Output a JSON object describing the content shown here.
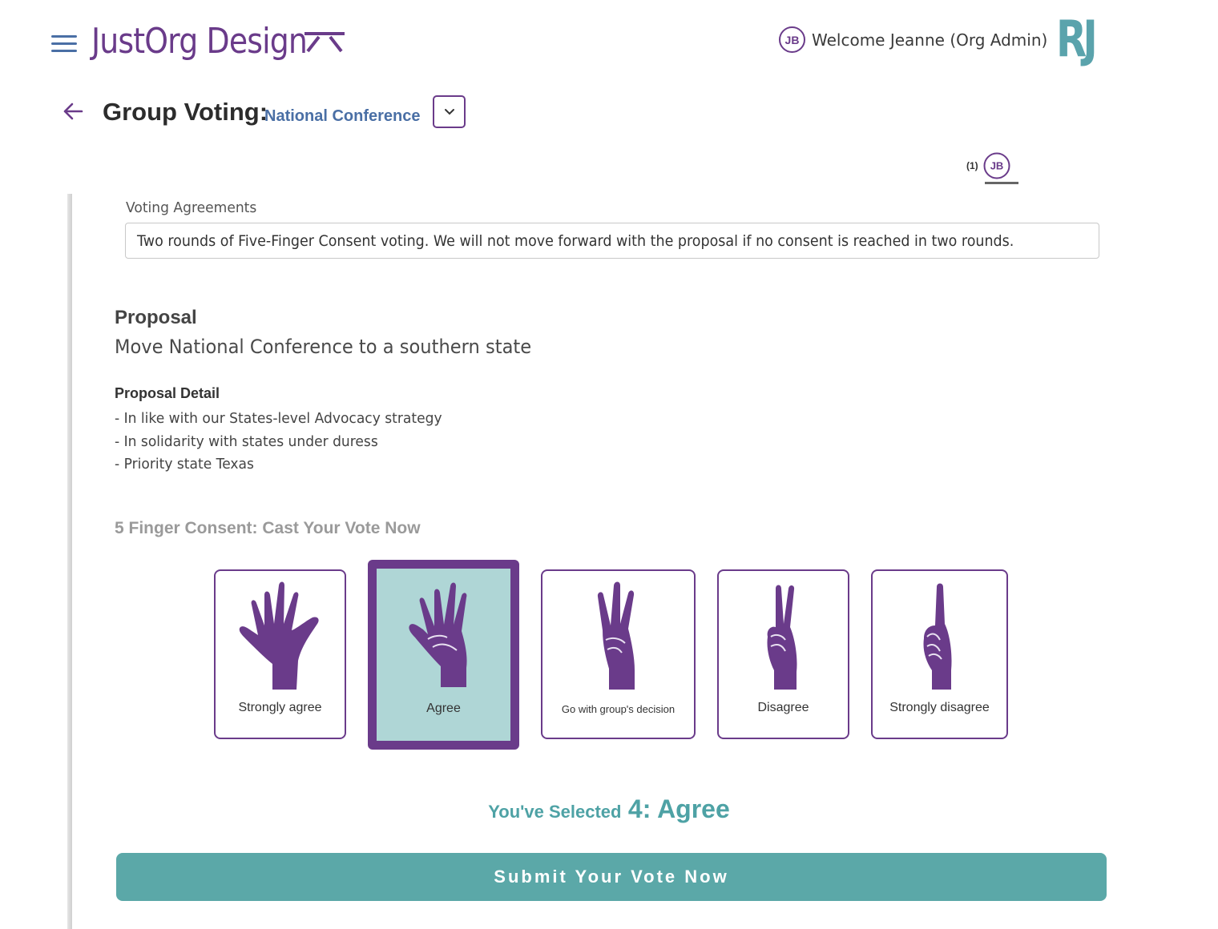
{
  "header": {
    "brand": "JustOrg Design",
    "user_initials": "JB",
    "welcome_text": "Welcome Jeanne (Org Admin)",
    "partner_logo": "RJ"
  },
  "title_row": {
    "title": "Group Voting:",
    "subtitle": "National Conference"
  },
  "participants": {
    "count": "(1)",
    "initials": "JB"
  },
  "voting_agreements": {
    "label": "Voting Agreements",
    "value": "Two rounds of Five-Finger Consent voting. We will not move forward with the proposal if no consent is reached in two rounds."
  },
  "proposal": {
    "heading": "Proposal",
    "title": "Move National Conference to a southern state",
    "detail_heading": "Proposal Detail",
    "details": [
      "- In like with our States-level Advocacy strategy",
      "- In solidarity with states under duress",
      "- Priority state Texas"
    ]
  },
  "vote": {
    "heading": "5 Finger Consent: Cast Your Vote Now",
    "options": [
      {
        "label": "Strongly agree",
        "icon": "five-fingers-hand-icon",
        "selected": false
      },
      {
        "label": "Agree",
        "icon": "four-fingers-hand-icon",
        "selected": true
      },
      {
        "label": "Go with group's decision",
        "icon": "three-fingers-hand-icon",
        "selected": false
      },
      {
        "label": "Disagree",
        "icon": "two-fingers-hand-icon",
        "selected": false
      },
      {
        "label": "Strongly disagree",
        "icon": "one-finger-hand-icon",
        "selected": false
      }
    ],
    "selected_prefix": "You've Selected",
    "selected_value": "4: Agree",
    "submit_label": "Submit Your Vote Now"
  },
  "colors": {
    "brand_purple": "#6a3b8a",
    "teal": "#5ba8a8",
    "selected_bg": "#afd6d6",
    "blue_accent": "#4a6fa5"
  }
}
